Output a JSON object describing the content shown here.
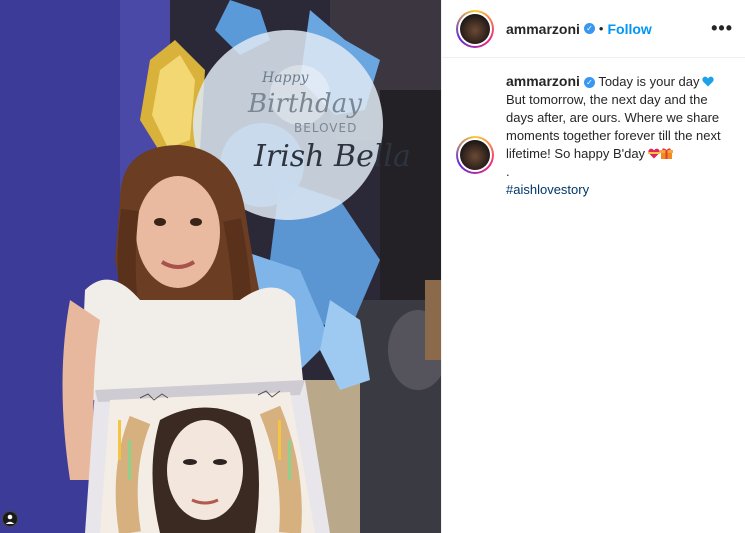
{
  "post": {
    "username": "ammarzoni",
    "follow_label": "Follow",
    "separator": "•",
    "more_label": "•••",
    "verified_mark": "✓"
  },
  "photo": {
    "balloon_text_1": "Happy",
    "balloon_text_2": "Birthday",
    "balloon_text_3": "BELOVED",
    "balloon_text_4": "Irish Bella"
  },
  "caption": {
    "username": "ammarzoni",
    "text": "Today is your day",
    "text_2": "But tomorrow, the next day and the days after, are ours. Where we share moments together forever till the next lifetime! So happy B'day",
    "dot": ".",
    "hashtag": "#aishlovestory"
  },
  "colors": {
    "accent": "#0095f6",
    "heart": "#1da1e8",
    "hashtag": "#00376b",
    "verified": "#3897f0"
  }
}
